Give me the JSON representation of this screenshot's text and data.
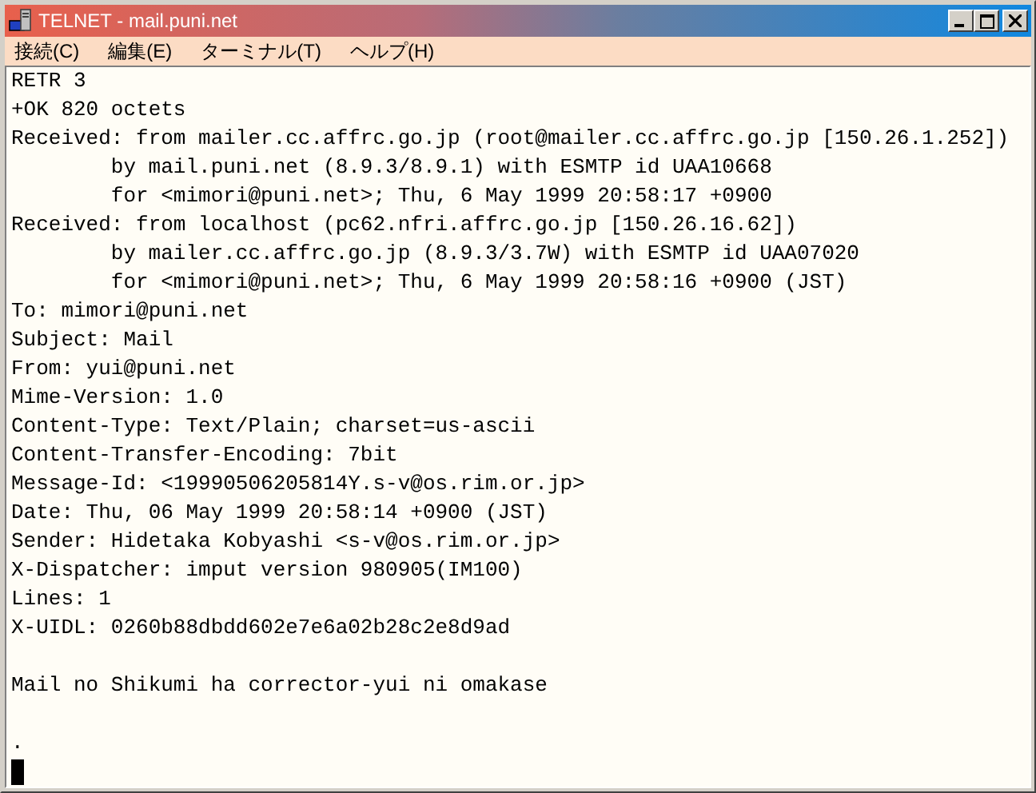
{
  "window": {
    "title": "TELNET - mail.puni.net"
  },
  "menu": [
    {
      "label": "接続(C)"
    },
    {
      "label": "編集(E)"
    },
    {
      "label": "ターミナル(T)"
    },
    {
      "label": "ヘルプ(H)"
    }
  ],
  "terminal": {
    "lines": [
      {
        "kind": "text",
        "text": "RETR 3"
      },
      {
        "kind": "text",
        "text": "+OK 820 octets"
      },
      {
        "kind": "text",
        "text": "Received: from mailer.cc.affrc.go.jp (root@mailer.cc.affrc.go.jp [150.26.1.252])"
      },
      {
        "kind": "indented",
        "text": "by mail.puni.net (8.9.3/8.9.1) with ESMTP id UAA10668"
      },
      {
        "kind": "indented",
        "text": "for <mimori@puni.net>; Thu, 6 May 1999 20:58:17 +0900"
      },
      {
        "kind": "text",
        "text": "Received: from localhost (pc62.nfri.affrc.go.jp [150.26.16.62])"
      },
      {
        "kind": "indented",
        "text": "by mailer.cc.affrc.go.jp (8.9.3/3.7W) with ESMTP id UAA07020"
      },
      {
        "kind": "indented",
        "text": "for <mimori@puni.net>; Thu, 6 May 1999 20:58:16 +0900 (JST)"
      },
      {
        "kind": "text",
        "text": "To: mimori@puni.net"
      },
      {
        "kind": "text",
        "text": "Subject: Mail"
      },
      {
        "kind": "text",
        "text": "From: yui@puni.net"
      },
      {
        "kind": "text",
        "text": "Mime-Version: 1.0"
      },
      {
        "kind": "text",
        "text": "Content-Type: Text/Plain; charset=us-ascii"
      },
      {
        "kind": "text",
        "text": "Content-Transfer-Encoding: 7bit"
      },
      {
        "kind": "text",
        "text": "Message-Id: <19990506205814Y.s-v@os.rim.or.jp>"
      },
      {
        "kind": "text",
        "text": "Date: Thu, 06 May 1999 20:58:14 +0900 (JST)"
      },
      {
        "kind": "text",
        "text": "Sender: Hidetaka Kobyashi <s-v@os.rim.or.jp>"
      },
      {
        "kind": "text",
        "text": "X-Dispatcher: imput version 980905(IM100)"
      },
      {
        "kind": "text",
        "text": "Lines: 1"
      },
      {
        "kind": "text",
        "text": "X-UIDL: 0260b88dbdd602e7e6a02b28c2e8d9ad"
      },
      {
        "kind": "blank"
      },
      {
        "kind": "text",
        "text": "Mail no Shikumi ha corrector-yui ni omakase"
      },
      {
        "kind": "blank"
      },
      {
        "kind": "text",
        "text": "."
      }
    ],
    "cursor": true
  }
}
